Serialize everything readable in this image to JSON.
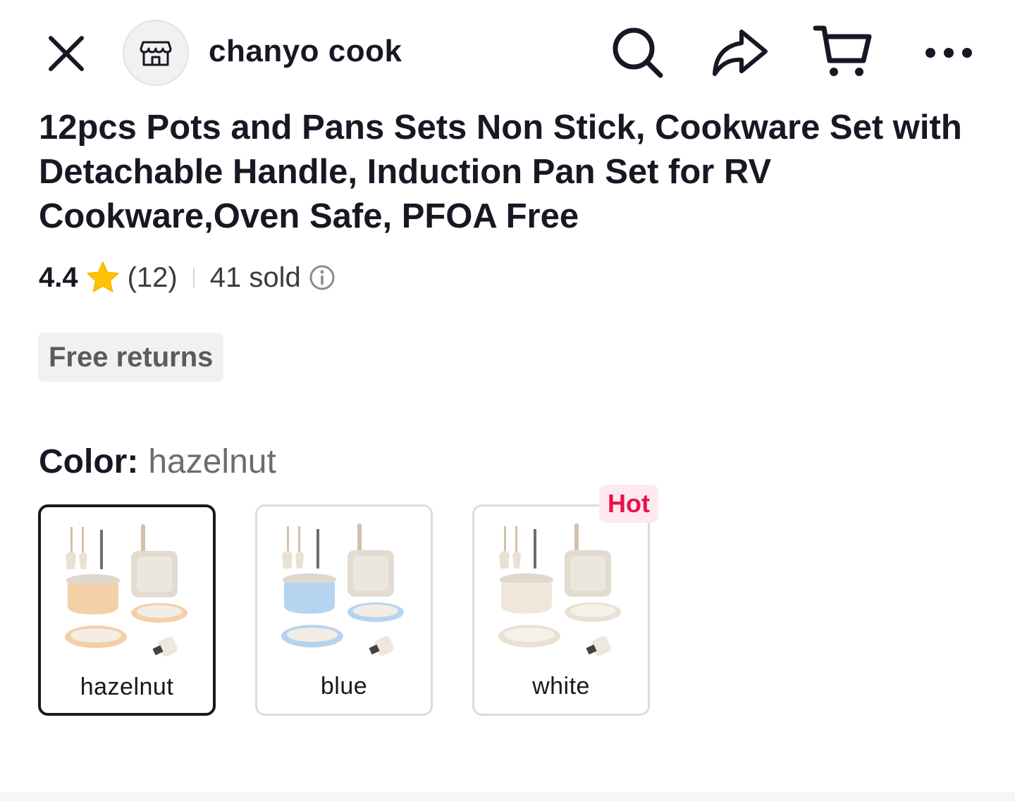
{
  "header": {
    "close_icon": "close-icon",
    "shop_icon": "storefront-icon",
    "shop_name": "chanyo cook",
    "search_icon": "search-icon",
    "share_icon": "share-icon",
    "cart_icon": "cart-icon",
    "more_icon": "more-icon"
  },
  "product": {
    "title": "12pcs Pots and Pans Sets Non Stick, Cookware Set with Detachable Handle, Induction Pan Set for RV Cookware,Oven Safe, PFOA Free",
    "rating": "4.4",
    "review_count": "(12)",
    "sold": "41 sold",
    "free_returns": "Free returns"
  },
  "color": {
    "key": "Color:",
    "selected": "hazelnut",
    "options": [
      {
        "label": "hazelnut",
        "accent": "#f3c79a"
      },
      {
        "label": "blue",
        "accent": "#a9cdee"
      },
      {
        "label": "white",
        "accent": "#efe3d3"
      }
    ],
    "hot_badge": "Hot"
  },
  "colors": {
    "text_primary": "#161823",
    "hot_text": "#e8114b",
    "hot_bg": "#fde9ee",
    "star": "#ffc300"
  }
}
